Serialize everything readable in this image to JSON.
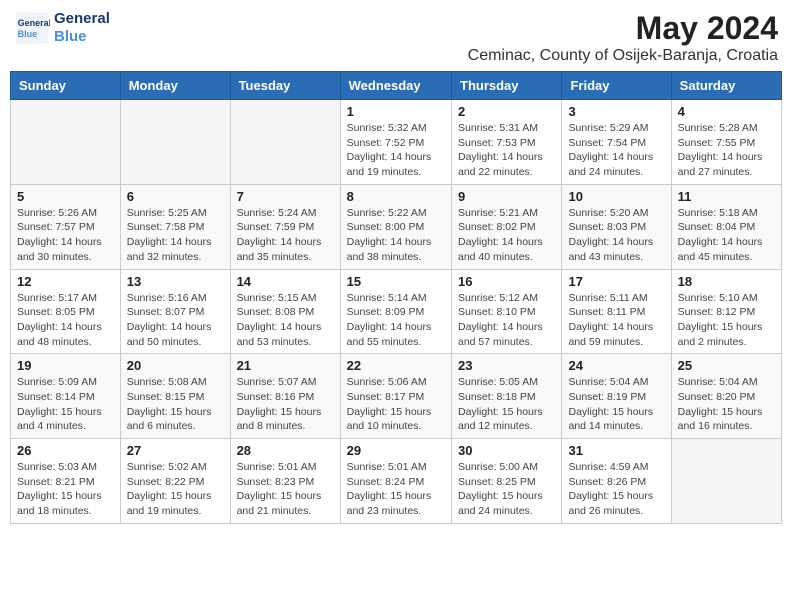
{
  "header": {
    "logo_line1": "General",
    "logo_line2": "Blue",
    "title": "May 2024",
    "subtitle": "Ceminac, County of Osijek-Baranja, Croatia"
  },
  "weekdays": [
    "Sunday",
    "Monday",
    "Tuesday",
    "Wednesday",
    "Thursday",
    "Friday",
    "Saturday"
  ],
  "weeks": [
    [
      {
        "day": "",
        "info": ""
      },
      {
        "day": "",
        "info": ""
      },
      {
        "day": "",
        "info": ""
      },
      {
        "day": "1",
        "info": "Sunrise: 5:32 AM\nSunset: 7:52 PM\nDaylight: 14 hours\nand 19 minutes."
      },
      {
        "day": "2",
        "info": "Sunrise: 5:31 AM\nSunset: 7:53 PM\nDaylight: 14 hours\nand 22 minutes."
      },
      {
        "day": "3",
        "info": "Sunrise: 5:29 AM\nSunset: 7:54 PM\nDaylight: 14 hours\nand 24 minutes."
      },
      {
        "day": "4",
        "info": "Sunrise: 5:28 AM\nSunset: 7:55 PM\nDaylight: 14 hours\nand 27 minutes."
      }
    ],
    [
      {
        "day": "5",
        "info": "Sunrise: 5:26 AM\nSunset: 7:57 PM\nDaylight: 14 hours\nand 30 minutes."
      },
      {
        "day": "6",
        "info": "Sunrise: 5:25 AM\nSunset: 7:58 PM\nDaylight: 14 hours\nand 32 minutes."
      },
      {
        "day": "7",
        "info": "Sunrise: 5:24 AM\nSunset: 7:59 PM\nDaylight: 14 hours\nand 35 minutes."
      },
      {
        "day": "8",
        "info": "Sunrise: 5:22 AM\nSunset: 8:00 PM\nDaylight: 14 hours\nand 38 minutes."
      },
      {
        "day": "9",
        "info": "Sunrise: 5:21 AM\nSunset: 8:02 PM\nDaylight: 14 hours\nand 40 minutes."
      },
      {
        "day": "10",
        "info": "Sunrise: 5:20 AM\nSunset: 8:03 PM\nDaylight: 14 hours\nand 43 minutes."
      },
      {
        "day": "11",
        "info": "Sunrise: 5:18 AM\nSunset: 8:04 PM\nDaylight: 14 hours\nand 45 minutes."
      }
    ],
    [
      {
        "day": "12",
        "info": "Sunrise: 5:17 AM\nSunset: 8:05 PM\nDaylight: 14 hours\nand 48 minutes."
      },
      {
        "day": "13",
        "info": "Sunrise: 5:16 AM\nSunset: 8:07 PM\nDaylight: 14 hours\nand 50 minutes."
      },
      {
        "day": "14",
        "info": "Sunrise: 5:15 AM\nSunset: 8:08 PM\nDaylight: 14 hours\nand 53 minutes."
      },
      {
        "day": "15",
        "info": "Sunrise: 5:14 AM\nSunset: 8:09 PM\nDaylight: 14 hours\nand 55 minutes."
      },
      {
        "day": "16",
        "info": "Sunrise: 5:12 AM\nSunset: 8:10 PM\nDaylight: 14 hours\nand 57 minutes."
      },
      {
        "day": "17",
        "info": "Sunrise: 5:11 AM\nSunset: 8:11 PM\nDaylight: 14 hours\nand 59 minutes."
      },
      {
        "day": "18",
        "info": "Sunrise: 5:10 AM\nSunset: 8:12 PM\nDaylight: 15 hours\nand 2 minutes."
      }
    ],
    [
      {
        "day": "19",
        "info": "Sunrise: 5:09 AM\nSunset: 8:14 PM\nDaylight: 15 hours\nand 4 minutes."
      },
      {
        "day": "20",
        "info": "Sunrise: 5:08 AM\nSunset: 8:15 PM\nDaylight: 15 hours\nand 6 minutes."
      },
      {
        "day": "21",
        "info": "Sunrise: 5:07 AM\nSunset: 8:16 PM\nDaylight: 15 hours\nand 8 minutes."
      },
      {
        "day": "22",
        "info": "Sunrise: 5:06 AM\nSunset: 8:17 PM\nDaylight: 15 hours\nand 10 minutes."
      },
      {
        "day": "23",
        "info": "Sunrise: 5:05 AM\nSunset: 8:18 PM\nDaylight: 15 hours\nand 12 minutes."
      },
      {
        "day": "24",
        "info": "Sunrise: 5:04 AM\nSunset: 8:19 PM\nDaylight: 15 hours\nand 14 minutes."
      },
      {
        "day": "25",
        "info": "Sunrise: 5:04 AM\nSunset: 8:20 PM\nDaylight: 15 hours\nand 16 minutes."
      }
    ],
    [
      {
        "day": "26",
        "info": "Sunrise: 5:03 AM\nSunset: 8:21 PM\nDaylight: 15 hours\nand 18 minutes."
      },
      {
        "day": "27",
        "info": "Sunrise: 5:02 AM\nSunset: 8:22 PM\nDaylight: 15 hours\nand 19 minutes."
      },
      {
        "day": "28",
        "info": "Sunrise: 5:01 AM\nSunset: 8:23 PM\nDaylight: 15 hours\nand 21 minutes."
      },
      {
        "day": "29",
        "info": "Sunrise: 5:01 AM\nSunset: 8:24 PM\nDaylight: 15 hours\nand 23 minutes."
      },
      {
        "day": "30",
        "info": "Sunrise: 5:00 AM\nSunset: 8:25 PM\nDaylight: 15 hours\nand 24 minutes."
      },
      {
        "day": "31",
        "info": "Sunrise: 4:59 AM\nSunset: 8:26 PM\nDaylight: 15 hours\nand 26 minutes."
      },
      {
        "day": "",
        "info": ""
      }
    ]
  ]
}
